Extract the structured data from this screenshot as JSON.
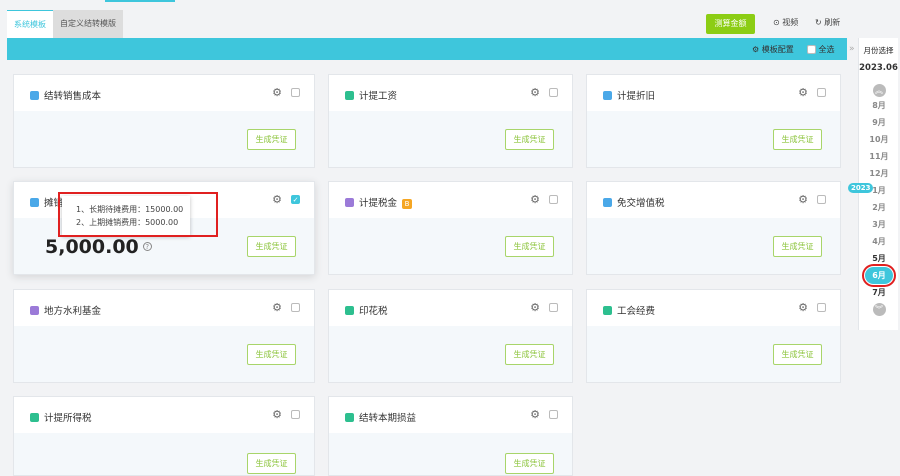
{
  "tabs": [
    "系统模板",
    "自定义结转模版"
  ],
  "toolbar": {
    "calc_all": "测算金额",
    "video": "视频",
    "refresh": "刷新",
    "template_config": "模板配置",
    "select_all": "全选"
  },
  "cards": [
    {
      "title": "结转销售成本",
      "button": "生成凭证",
      "checked": false,
      "icon_color": "#4aa8e8"
    },
    {
      "title": "计提工资",
      "button": "生成凭证",
      "checked": false,
      "icon_color": "#2dbf8f"
    },
    {
      "title": "计提折旧",
      "button": "生成凭证",
      "checked": false,
      "icon_color": "#4aa8e8"
    },
    {
      "title": "摊销待摊费用",
      "button": "生成凭证",
      "checked": true,
      "amount": "5,000.00",
      "icon_color": "#4aa8e8"
    },
    {
      "title": "计提税金",
      "button": "生成凭证",
      "checked": false,
      "badge": "B",
      "icon_color": "#9b7ad8"
    },
    {
      "title": "免交增值税",
      "button": "生成凭证",
      "checked": false,
      "icon_color": "#4aa8e8"
    },
    {
      "title": "地方水利基金",
      "button": "生成凭证",
      "checked": false,
      "icon_color": "#9b7ad8"
    },
    {
      "title": "印花税",
      "button": "生成凭证",
      "checked": false,
      "icon_color": "#2dbf8f"
    },
    {
      "title": "工会经费",
      "button": "生成凭证",
      "checked": false,
      "icon_color": "#2dbf8f"
    },
    {
      "title": "计提所得税",
      "button": "生成凭证",
      "checked": false,
      "icon_color": "#2dbf8f"
    },
    {
      "title": "结转本期损益",
      "button": "生成凭证",
      "checked": false,
      "icon_color": "#2dbf8f"
    }
  ],
  "tooltip": [
    "1、长期待摊费用：15000.00",
    "2、上期摊销费用：5000.00"
  ],
  "month_picker": {
    "title": "月份选择",
    "current": "2023.06",
    "year_badge": "2023",
    "months": [
      "8月",
      "9月",
      "10月",
      "11月",
      "12月",
      "1月",
      "2月",
      "3月",
      "4月",
      "5月",
      "6月",
      "7月"
    ],
    "selected": "6月"
  }
}
